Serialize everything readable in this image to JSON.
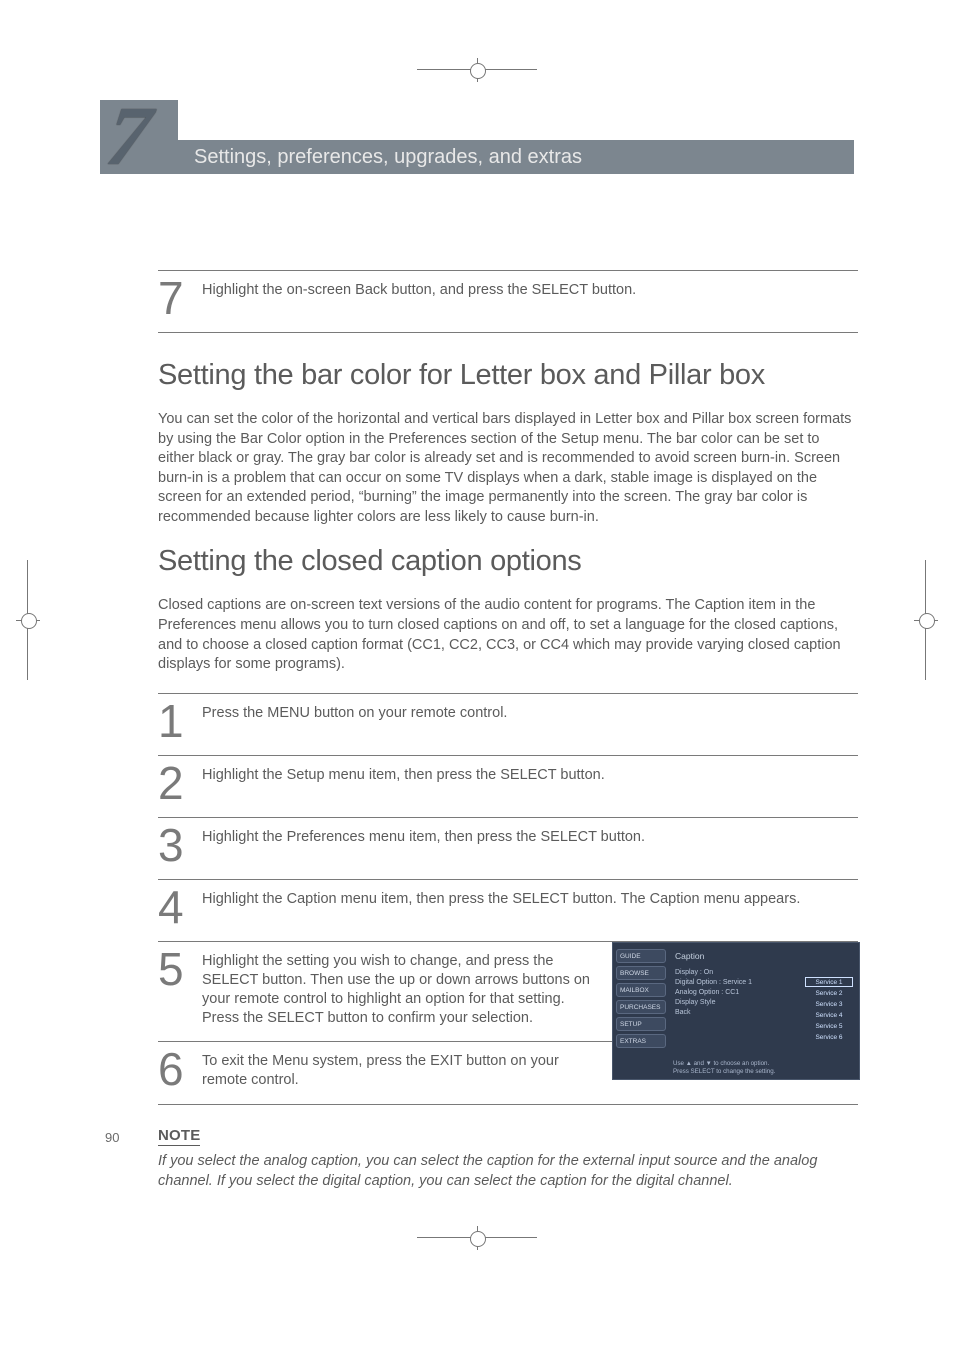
{
  "chapter": {
    "number": "7",
    "subtitle": "Settings, preferences, upgrades, and extras"
  },
  "intro_step": {
    "num": "7",
    "text": "Highlight the on-screen Back button, and press the SELECT button."
  },
  "section1": {
    "title": "Setting the bar color for Letter box and Pillar box",
    "body": "You can set the color of the horizontal and vertical bars displayed in Letter box and Pillar box screen formats by using the Bar Color option in the Preferences section of the Setup menu. The bar color can be set to either black or gray. The gray bar color is already set and is recommended to avoid screen burn-in. Screen burn-in is a problem that can occur on some TV displays when a dark, stable image is displayed on the screen for an extended period, “burning” the image permanently into the screen. The gray bar color is recommended because lighter colors are less likely to cause burn-in."
  },
  "section2": {
    "title": "Setting the closed caption options",
    "body": "Closed captions are on-screen text versions of the audio content for programs. The Caption item in the Preferences menu allows you to turn closed captions on and off, to set a language for the closed captions, and to choose a closed caption format (CC1, CC2, CC3, or CC4 which may provide varying closed caption displays for some programs)."
  },
  "steps": [
    {
      "num": "1",
      "text": "Press the MENU button on your remote control."
    },
    {
      "num": "2",
      "text": "Highlight the Setup menu item, then press the SELECT button."
    },
    {
      "num": "3",
      "text": "Highlight the Preferences menu item, then press the SELECT button."
    },
    {
      "num": "4",
      "text": "Highlight the Caption menu item, then press the SELECT button. The Caption menu appears."
    },
    {
      "num": "5",
      "text": "Highlight the setting you wish to change, and press the SELECT button. Then use the up or down arrows buttons on your remote control to highlight an option for that setting. Press the SELECT button to confirm your selection."
    },
    {
      "num": "6",
      "text": "To exit the Menu system, press the EXIT button on your remote control."
    }
  ],
  "ui": {
    "title": "Caption",
    "tabs": [
      "GUIDE",
      "BROWSE",
      "MAILBOX",
      "PURCHASES",
      "SETUP",
      "EXTRAS"
    ],
    "rows": [
      "Display : On",
      "Digital Option : Service 1",
      "Analog Option : CC1",
      "Display Style",
      "Back"
    ],
    "options": [
      "Service 1",
      "Service 2",
      "Service 3",
      "Service 4",
      "Service 5",
      "Service 6"
    ],
    "hint1": "Use ▲ and ▼ to choose an option.",
    "hint2": "Press SELECT to change the setting."
  },
  "note": {
    "label": "NOTE",
    "text": "If you select the analog caption, you can select the caption for the external input source and the analog channel. If you select the digital caption, you can select the caption for the digital channel."
  },
  "page_number": "90"
}
